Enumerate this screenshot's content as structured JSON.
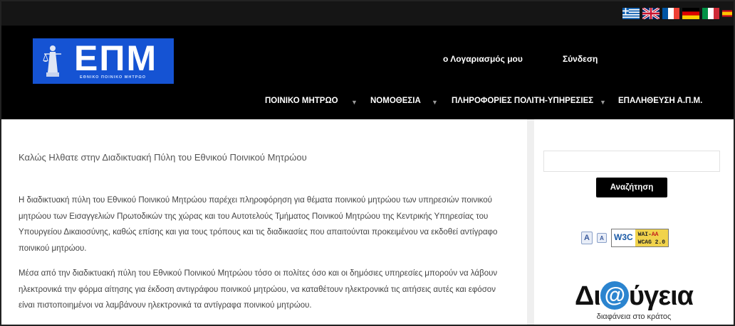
{
  "flags": [
    {
      "icon": "greek-flag-icon"
    },
    {
      "icon": "uk-flag-icon"
    },
    {
      "icon": "french-flag-icon"
    },
    {
      "icon": "german-flag-icon"
    },
    {
      "icon": "italian-flag-icon"
    },
    {
      "icon": "spanish-flag-icon"
    }
  ],
  "logo": {
    "mark": "ΕΠΜ",
    "subtitle": "ΕΘΝΙΚΟ ΠΟΙΝΙΚΟ ΜΗΤΡΩΟ"
  },
  "account": {
    "my_account": "ο Λογαριασμός μου",
    "login": "Σύνδεση"
  },
  "nav": {
    "items": [
      {
        "label": "ΠΟΙΝΙΚΟ ΜΗΤΡΩΟ"
      },
      {
        "label": "ΝΟΜΟΘΕΣΙΑ"
      },
      {
        "label": "ΠΛΗΡΟΦΟΡΙΕΣ ΠΟΛΙΤΗ-ΥΠΗΡΕΣΙΕΣ"
      },
      {
        "label": "ΕΠΑΛΗΘΕΥΣΗ Α.Π.Μ."
      }
    ],
    "caret": "▼"
  },
  "main": {
    "welcome": "Καλώς Ηλθατε στην Διαδικτυακή Πύλη του Εθνικού Ποινικού Μητρώου",
    "paragraph1": "Η διαδικτυακή πύλη του Εθνικού Ποινικού Μητρώου παρέχει πληροφόρηση για θέματα  ποινικού μητρώου των υπηρεσιών ποινικού μητρώου των Εισαγγελιών Πρωτοδικών της χώρας και του Αυτοτελούς Τμήματος Ποινικού Μητρώου της Κεντρικής Υπηρεσίας του Υπουργείου Δικαιοσύνης, καθώς επίσης και για τους τρόπους και τις διαδικασίες που απαιτούνται προκειμένου να εκδοθεί αντίγραφο ποινικού μητρώου.",
    "paragraph2": "Μέσα από την διαδικτυακή πύλη του Εθνικού Ποινικού Μητρώου τόσο οι πολίτες όσο και οι δημόσιες υπηρεσίες μπορούν να λάβουν ηλεκτρονικά την φόρμα αίτησης για έκδοση αντιγράφου ποινικού μητρώου, να καταθέτουν ηλεκτρονικά τις αιτήσεις αυτές και εφόσον είναι πιστοποιημένοι να λαμβάνουν ηλεκτρονικά τα αντίγραφα ποινικού μητρώου."
  },
  "sidebar": {
    "search_value": "",
    "search_button": "Αναζήτηση",
    "font_increase": "A",
    "font_decrease": "A",
    "w3c": "W3C",
    "wai_line1": "WAI-",
    "wai_aa": "AA",
    "wcag_line2": "WCAG 2.0",
    "diavgeia_pre": "Δι",
    "diavgeia_at": "@",
    "diavgeia_post": "ύγεια",
    "diavgeia_tagline": "διαφάνεια στο κράτος"
  },
  "colors": {
    "header_bg": "#000000",
    "logo_blue": "#1553d3",
    "search_button_bg": "#000000",
    "diavgeia_blue": "#2b84cf"
  }
}
